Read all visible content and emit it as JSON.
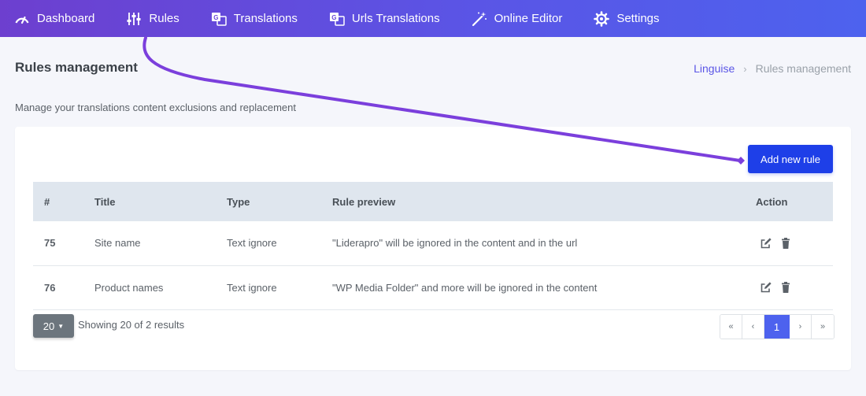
{
  "nav": {
    "items": [
      {
        "label": "Dashboard",
        "icon": "gauge-icon"
      },
      {
        "label": "Rules",
        "icon": "sliders-icon"
      },
      {
        "label": "Translations",
        "icon": "translate-icon"
      },
      {
        "label": "Urls Translations",
        "icon": "translate-icon"
      },
      {
        "label": "Online Editor",
        "icon": "magic-wand-icon"
      },
      {
        "label": "Settings",
        "icon": "gear-icon"
      }
    ]
  },
  "header": {
    "title": "Rules management",
    "breadcrumb": {
      "root": "Linguise",
      "separator": "›",
      "current": "Rules management"
    },
    "subtitle": "Manage your translations content exclusions and replacement"
  },
  "toolbar": {
    "add_label": "Add new rule"
  },
  "table": {
    "columns": [
      "#",
      "Title",
      "Type",
      "Rule preview",
      "Action"
    ],
    "rows": [
      {
        "id": "75",
        "title": "Site name",
        "type": "Text ignore",
        "preview": "\"Liderapro\" will be ignored in the content and in the url"
      },
      {
        "id": "76",
        "title": "Product names",
        "type": "Text ignore",
        "preview": "\"WP Media Folder\" and more will be ignored in the content"
      }
    ]
  },
  "footer": {
    "per_page": "20",
    "showing": "Showing 20 of 2 results",
    "pagination": {
      "first": "«",
      "prev": "‹",
      "current": "1",
      "next": "›",
      "last": "»"
    }
  },
  "colors": {
    "accent": "#5a55e6",
    "button": "#1e3fe8",
    "annotation": "#7b3fdc"
  }
}
